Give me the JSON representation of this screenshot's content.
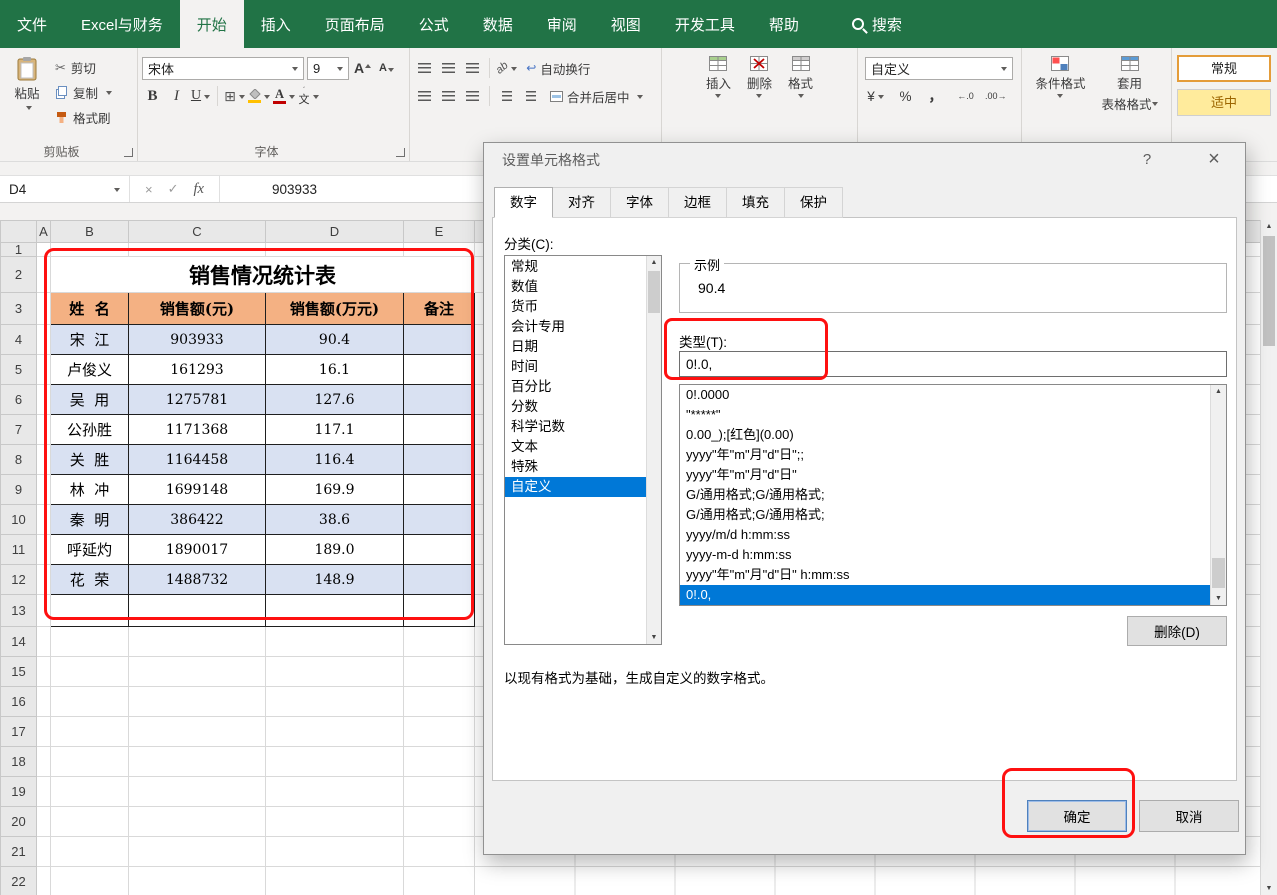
{
  "menu": {
    "tabs": [
      "文件",
      "Excel与财务",
      "开始",
      "插入",
      "页面布局",
      "公式",
      "数据",
      "审阅",
      "视图",
      "开发工具",
      "帮助"
    ],
    "search_label": "搜索"
  },
  "ribbon": {
    "paste": "粘贴",
    "cut": "剪切",
    "copy": "复制",
    "format_painter": "格式刷",
    "clipboard_group": "剪贴板",
    "font_name": "宋体",
    "font_size": "9",
    "bold": "B",
    "italic": "I",
    "underline": "U",
    "font_group": "字体",
    "wrap_text": "自动换行",
    "merge_center": "合并后居中",
    "insert": "插入",
    "delete": "删除",
    "format": "格式",
    "number_format": "自定义",
    "conditional": "条件格式",
    "format_table_line1": "套用",
    "format_table_line2": "表格格式",
    "style_normal": "常规",
    "style_moderate": "适中"
  },
  "formula_bar": {
    "name_box": "D4",
    "fx": "fx",
    "value": "903933"
  },
  "sheet": {
    "col_labels": [
      "A",
      "B",
      "C",
      "D",
      "E"
    ],
    "row_labels": [
      "1",
      "2",
      "3",
      "4",
      "5",
      "6",
      "7",
      "8",
      "9",
      "10",
      "11",
      "12",
      "13",
      "14",
      "15",
      "16",
      "17",
      "18",
      "19",
      "20",
      "21",
      "22"
    ],
    "table": {
      "title": "销售情况统计表",
      "headers": [
        "姓  名",
        "销售额(元)",
        "销售额(万元)",
        "备注"
      ],
      "rows": [
        {
          "name": "宋  江",
          "sales": "903933",
          "wan": "90.4"
        },
        {
          "name": "卢俊义",
          "sales": "161293",
          "wan": "16.1"
        },
        {
          "name": "吴  用",
          "sales": "1275781",
          "wan": "127.6"
        },
        {
          "name": "公孙胜",
          "sales": "1171368",
          "wan": "117.1"
        },
        {
          "name": "关  胜",
          "sales": "1164458",
          "wan": "116.4"
        },
        {
          "name": "林  冲",
          "sales": "1699148",
          "wan": "169.9"
        },
        {
          "name": "秦  明",
          "sales": "386422",
          "wan": "38.6"
        },
        {
          "name": "呼延灼",
          "sales": "1890017",
          "wan": "189.0"
        },
        {
          "name": "花  荣",
          "sales": "1488732",
          "wan": "148.9"
        }
      ]
    }
  },
  "dialog": {
    "title": "设置单元格格式",
    "help": "?",
    "close": "×",
    "tabs": [
      "数字",
      "对齐",
      "字体",
      "边框",
      "填充",
      "保护"
    ],
    "category_label": "分类(C):",
    "categories": [
      "常规",
      "数值",
      "货币",
      "会计专用",
      "日期",
      "时间",
      "百分比",
      "分数",
      "科学记数",
      "文本",
      "特殊",
      "自定义"
    ],
    "sample_label": "示例",
    "sample_value": "90.4",
    "type_label": "类型(T):",
    "type_value": "0!.0,",
    "formats": [
      "0!.0000",
      "\"*****\"",
      "0.00_);[红色](0.00)",
      "yyyy\"年\"m\"月\"d\"日\";;",
      "yyyy\"年\"m\"月\"d\"日\"",
      "G/通用格式;G/通用格式;",
      "G/通用格式;G/通用格式;",
      "yyyy/m/d h:mm:ss",
      "yyyy-m-d h:mm:ss",
      "yyyy\"年\"m\"月\"d\"日\" h:mm:ss",
      "0!.0,"
    ],
    "delete_button": "删除(D)",
    "description": "以现有格式为基础，生成自定义的数字格式。",
    "ok": "确定",
    "cancel": "取消"
  },
  "icons": {
    "cut": "✂",
    "borders": "⊞",
    "font_color": "A",
    "grow_font": "A",
    "shrink_font": "A",
    "orientation": "ab",
    "wrap_arrow": "↩",
    "accounting": "¥",
    "percent": "%",
    "comma": "，",
    "increase_decimal": "←.0",
    "decrease_decimal": ".00→",
    "scroll_up": "▲",
    "scroll_down": "▼",
    "cancel": "×",
    "enter": "✓",
    "phonetic_mark": "ˊ",
    "phonetic_char": "文"
  },
  "colors": {
    "accent_green": "#217346",
    "selection_blue": "#0078d7",
    "table_header": "#f4b183",
    "table_stripe": "#d9e1f2",
    "annotation_red": "#fe1010",
    "style_moderate_bg": "#ffeb9c"
  }
}
